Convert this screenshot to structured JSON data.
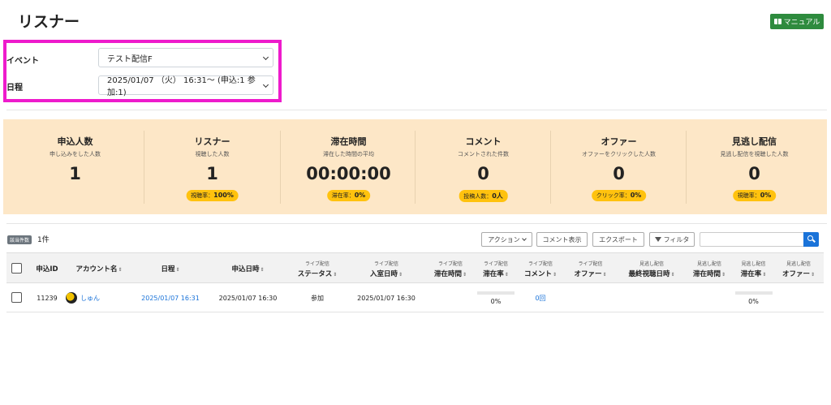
{
  "page": {
    "title": "リスナー"
  },
  "manual_button": {
    "label": "マニュアル",
    "icon": "book-icon"
  },
  "filters": {
    "event": {
      "label": "イベント",
      "value": "テスト配信F"
    },
    "schedule": {
      "label": "日程",
      "value": "2025/01/07 （火） 16:31〜 (申込:1 参加:1)"
    }
  },
  "stats": [
    {
      "name": "申込人数",
      "desc": "申し込みをした人数",
      "value": "1",
      "pill_label": "",
      "pill_value": ""
    },
    {
      "name": "リスナー",
      "desc": "視聴した人数",
      "value": "1",
      "pill_label": "視聴率：",
      "pill_value": "100%"
    },
    {
      "name": "滞在時間",
      "desc": "滞在した時間の平均",
      "value": "00:00:00",
      "pill_label": "滞在率：",
      "pill_value": "0%"
    },
    {
      "name": "コメント",
      "desc": "コメントされた件数",
      "value": "0",
      "pill_label": "投稿人数：",
      "pill_value": "0人"
    },
    {
      "name": "オファー",
      "desc": "オファーをクリックした人数",
      "value": "0",
      "pill_label": "クリック率：",
      "pill_value": "0%"
    },
    {
      "name": "見逃し配信",
      "desc": "見逃し配信を視聴した人数",
      "value": "0",
      "pill_label": "視聴率：",
      "pill_value": "0%"
    }
  ],
  "results": {
    "badge": "該当件数",
    "count": "1件"
  },
  "toolbar": {
    "action": "アクション",
    "show_comments": "コメント表示",
    "export": "エクスポート",
    "filter": "フィルタ"
  },
  "table": {
    "sort_icon": "⇕",
    "columns": [
      {
        "sub": "",
        "main": "申込ID",
        "sort": false
      },
      {
        "sub": "",
        "main": "アカウント名",
        "sort": true
      },
      {
        "sub": "",
        "main": "日程",
        "sort": true
      },
      {
        "sub": "",
        "main": "申込日時",
        "sort": true
      },
      {
        "sub": "ライブ配信",
        "main": "ステータス",
        "sort": true
      },
      {
        "sub": "ライブ配信",
        "main": "入室日時",
        "sort": true
      },
      {
        "sub": "ライブ配信",
        "main": "滞在時間",
        "sort": true
      },
      {
        "sub": "ライブ配信",
        "main": "滞在率",
        "sort": true
      },
      {
        "sub": "ライブ配信",
        "main": "コメント",
        "sort": true
      },
      {
        "sub": "ライブ配信",
        "main": "オファー",
        "sort": true
      },
      {
        "sub": "見逃し配信",
        "main": "最終視聴日時",
        "sort": true
      },
      {
        "sub": "見逃し配信",
        "main": "滞在時間",
        "sort": true
      },
      {
        "sub": "見逃し配信",
        "main": "滞在率",
        "sort": true
      },
      {
        "sub": "見逃し配信",
        "main": "オファー",
        "sort": true
      }
    ],
    "rows": [
      {
        "id": "11239",
        "account": "しゅん",
        "schedule": "2025/01/07 16:31",
        "applied_at": "2025/01/07 16:30",
        "live_status": "参加",
        "live_entry": "2025/01/07 16:30",
        "live_stay_time": "",
        "live_stay_rate": "0%",
        "live_comments": "0回",
        "live_offer": "",
        "archive_last_view": "",
        "archive_stay_time": "",
        "archive_stay_rate": "0%",
        "archive_offer": ""
      }
    ]
  }
}
